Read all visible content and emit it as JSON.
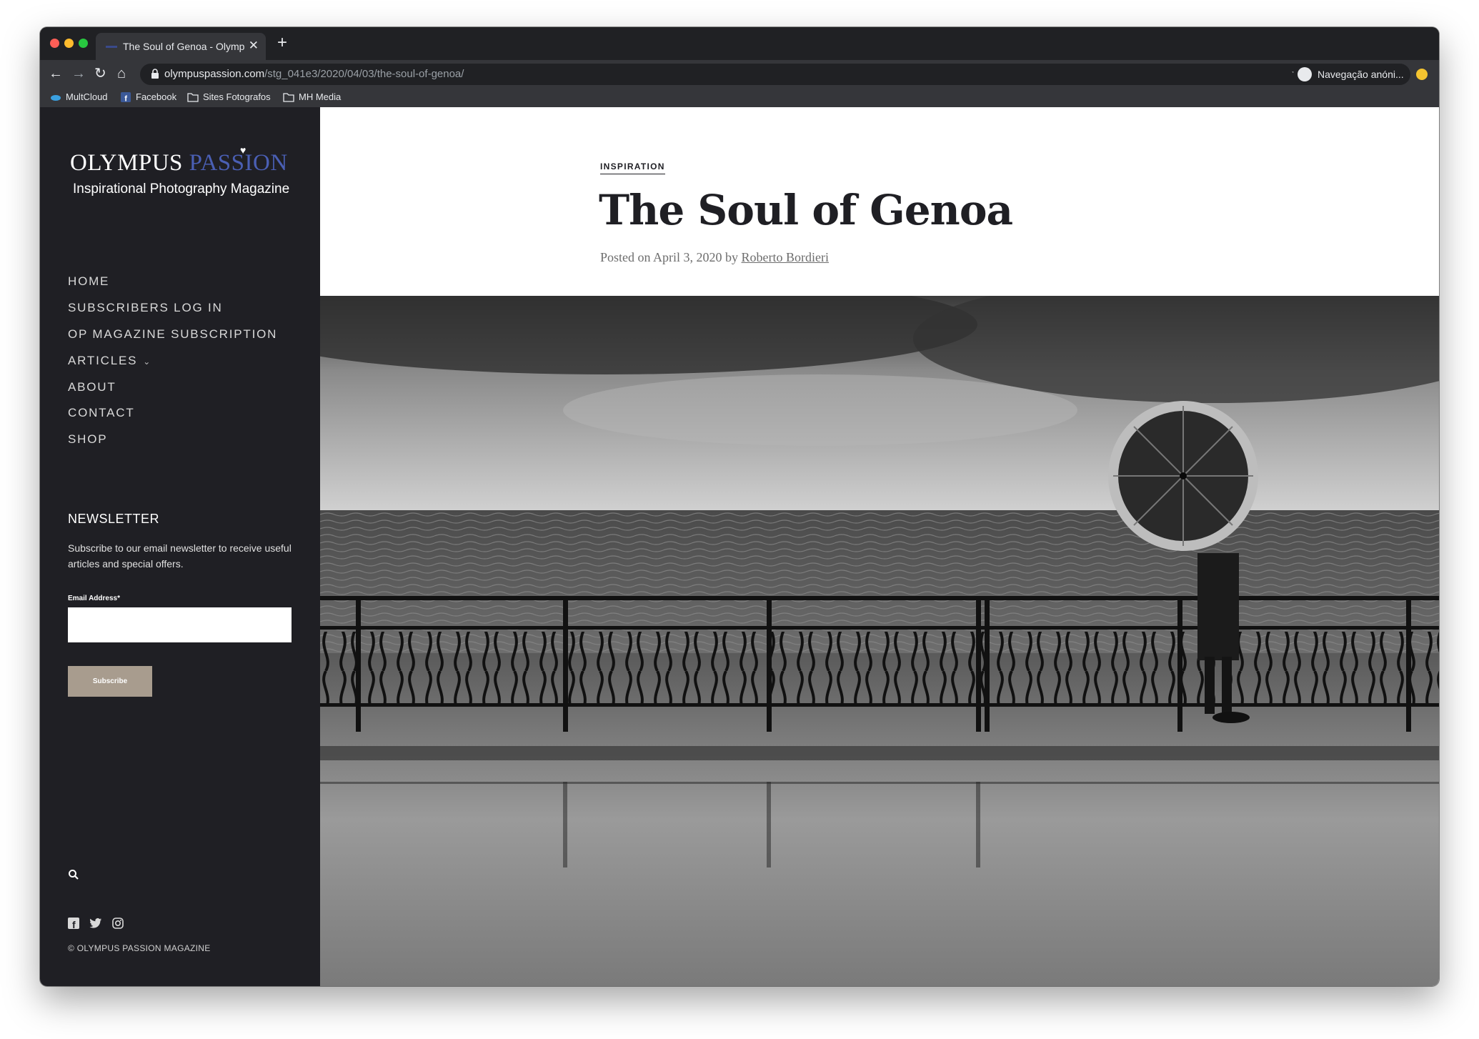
{
  "browser": {
    "tab_title": "The Soul of Genoa - Olympus P",
    "url_host": "olympuspassion.com",
    "url_path": "/stg_041e3/2020/04/03/the-soul-of-genoa/",
    "profile_label": "Navegação anóni...",
    "bookmarks": [
      {
        "label": "MultCloud",
        "icon": "cloud-icon"
      },
      {
        "label": "Facebook",
        "icon": "facebook-icon"
      },
      {
        "label": "Sites Fotografos",
        "icon": "folder-icon"
      },
      {
        "label": "MH Media",
        "icon": "folder-icon"
      }
    ]
  },
  "sidebar": {
    "logo": {
      "word1": "OLYMPUS",
      "word2": "PASSION",
      "tagline": "Inspirational Photography Magazine"
    },
    "menu": [
      {
        "label": "HOME"
      },
      {
        "label": "SUBSCRIBERS LOG IN"
      },
      {
        "label": "OP MAGAZINE SUBSCRIPTION"
      },
      {
        "label": "ARTICLES",
        "has_submenu": true
      },
      {
        "label": "ABOUT"
      },
      {
        "label": "CONTACT"
      },
      {
        "label": "SHOP"
      }
    ],
    "newsletter": {
      "title": "NEWSLETTER",
      "text": "Subscribe to our email newsletter to receive useful articles and special offers.",
      "email_label": "Email Address*",
      "email_value": "",
      "button_label": "Subscribe"
    },
    "copyright": "© OLYMPUS PASSION MAGAZINE"
  },
  "post": {
    "category": "INSPIRATION",
    "title": "The Soul of Genoa",
    "meta_prefix": "Posted on April 3, 2020 by",
    "author": "Roberto Bordieri"
  },
  "colors": {
    "sidebar_bg": "#1f1f24",
    "accent_blue": "#4a5fb4",
    "button_bg": "#a89c8e"
  }
}
